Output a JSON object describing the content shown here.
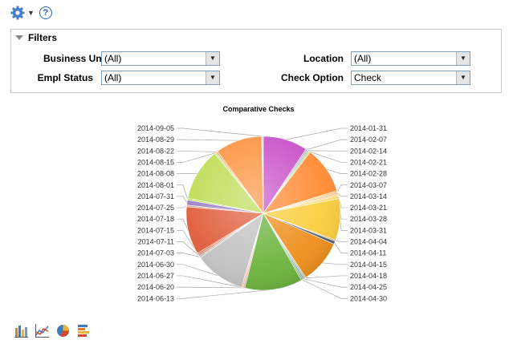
{
  "toolbar": {
    "icons": [
      "gear-icon",
      "dropdown-caret-icon",
      "help-icon"
    ],
    "help_glyph": "?"
  },
  "filters": {
    "title": "Filters",
    "business_unit": {
      "label": "Business Unit",
      "value": "(All)"
    },
    "empl_status": {
      "label": "Empl Status",
      "value": "(All)"
    },
    "location": {
      "label": "Location",
      "value": "(All)"
    },
    "check_option": {
      "label": "Check Option",
      "value": "Check"
    }
  },
  "chart_data": {
    "type": "pie",
    "title": "Comparative Checks",
    "legend_left": [
      "2014-09-05",
      "2014-08-29",
      "2014-08-22",
      "2014-08-15",
      "2014-08-08",
      "2014-08-01",
      "2014-07-31",
      "2014-07-25",
      "2014-07-18",
      "2014-07-15",
      "2014-07-11",
      "2014-07-03",
      "2014-06-30",
      "2014-06-27",
      "2014-06-20",
      "2014-06-13"
    ],
    "legend_right": [
      "2014-01-31",
      "2014-02-07",
      "2014-02-14",
      "2014-02-21",
      "2014-02-28",
      "2014-03-07",
      "2014-03-14",
      "2014-03-21",
      "2014-03-28",
      "2014-03-31",
      "2014-04-04",
      "2014-04-11",
      "2014-04-15",
      "2014-04-18",
      "2014-04-25",
      "2014-04-30"
    ],
    "slices": [
      {
        "label": "2014-01-31",
        "value": 10.5,
        "color": "#c84fc8"
      },
      {
        "label": "2014-02-07",
        "value": 0.4,
        "color": "#b7a8c0"
      },
      {
        "label": "2014-02-14",
        "value": 0.4,
        "color": "#9bc4a8"
      },
      {
        "label": "2014-02-21",
        "value": 0.4,
        "color": "#c8d98b"
      },
      {
        "label": "2014-02-28",
        "value": 11.1,
        "color": "#ff8a33"
      },
      {
        "label": "2014-03-07",
        "value": 0.4,
        "color": "#f1c66a"
      },
      {
        "label": "2014-03-14",
        "value": 0.4,
        "color": "#f2b28d"
      },
      {
        "label": "2014-03-21",
        "value": 0.4,
        "color": "#f7d977"
      },
      {
        "label": "2014-03-28",
        "value": 0.7,
        "color": "#fcdc74"
      },
      {
        "label": "2014-03-31",
        "value": 9.8,
        "color": "#f9cd3b"
      },
      {
        "label": "2014-04-04",
        "value": 0.3,
        "color": "#e2a454"
      },
      {
        "label": "2014-04-11",
        "value": 0.7,
        "color": "#4e5f76"
      },
      {
        "label": "2014-04-15",
        "value": 10.3,
        "color": "#ed8f1b"
      },
      {
        "label": "2014-04-18",
        "value": 0.4,
        "color": "#bdd38a"
      },
      {
        "label": "2014-04-25",
        "value": 0.4,
        "color": "#79a9c8"
      },
      {
        "label": "2014-04-30",
        "value": 0.4,
        "color": "#9bba6d"
      },
      {
        "label": "2014-06-13",
        "value": 13.6,
        "color": "#6cb33e"
      },
      {
        "label": "2014-06-20",
        "value": 0.4,
        "color": "#e8b2a5"
      },
      {
        "label": "2014-06-27",
        "value": 0.4,
        "color": "#f2c4a3"
      },
      {
        "label": "2014-06-30",
        "value": 12.0,
        "color": "#c2c2c2"
      },
      {
        "label": "2014-07-03",
        "value": 0.4,
        "color": "#b8b8b8"
      },
      {
        "label": "2014-07-11",
        "value": 0.4,
        "color": "#e07e64"
      },
      {
        "label": "2014-07-15",
        "value": 0.4,
        "color": "#e46f4a"
      },
      {
        "label": "2014-07-18",
        "value": 11.3,
        "color": "#e05c3a"
      },
      {
        "label": "2014-07-25",
        "value": 0.4,
        "color": "#d4a28c"
      },
      {
        "label": "2014-07-31",
        "value": 1.2,
        "color": "#9c7fc8"
      },
      {
        "label": "2014-08-01",
        "value": 0.4,
        "color": "#b8dc52"
      },
      {
        "label": "2014-08-08",
        "value": 12.4,
        "color": "#bedc53"
      },
      {
        "label": "2014-08-15",
        "value": 0.4,
        "color": "#c9e174"
      },
      {
        "label": "2014-08-22",
        "value": 0.4,
        "color": "#f2a45d"
      },
      {
        "label": "2014-08-29",
        "value": 11.0,
        "color": "#fb923d"
      },
      {
        "label": "2014-09-05",
        "value": 0.4,
        "color": "#d9d9d9"
      }
    ]
  },
  "bottom_icons": [
    "bar-chart-icon",
    "line-chart-icon",
    "pie-chart-icon",
    "stacked-bar-icon"
  ]
}
